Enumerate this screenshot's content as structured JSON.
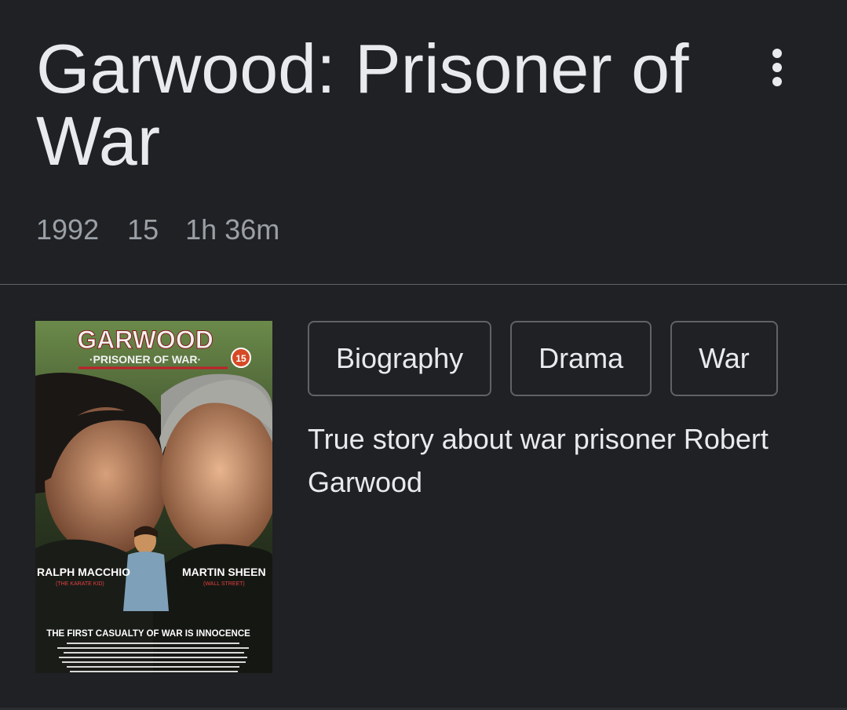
{
  "title": "Garwood: Prisoner of War",
  "meta": {
    "year": "1992",
    "rating": "15",
    "duration": "1h 36m"
  },
  "menu": {
    "icon": "more-vert-icon"
  },
  "poster": {
    "headline": "GARWOOD",
    "subheadline": "·PRISONER OF WAR·",
    "age_badge": "15",
    "actor_left": "RALPH MACCHIO",
    "actor_left_credit": "(THE KARATE KID)",
    "actor_right": "MARTIN SHEEN",
    "actor_right_credit": "(WALL STREET)",
    "tagline": "THE FIRST CASUALTY OF WAR IS INNOCENCE"
  },
  "genres": [
    "Biography",
    "Drama",
    "War"
  ],
  "description": "True story about war prisoner Robert Garwood",
  "colors": {
    "background": "#202124",
    "text_primary": "#e8eaed",
    "text_secondary": "#9aa0a6",
    "border": "#5f6368"
  }
}
